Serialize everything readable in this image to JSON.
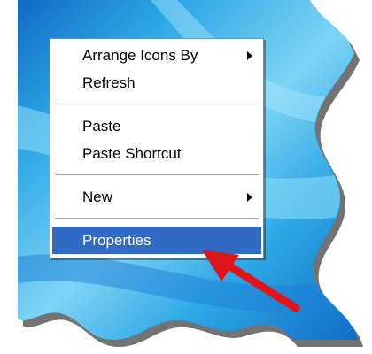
{
  "desktop": {
    "background_colors": {
      "light": "#7fd4f5",
      "mid": "#2fa8e6",
      "dark": "#0b64c2",
      "shadow": "#000000"
    }
  },
  "context_menu": {
    "items": [
      {
        "label": "Arrange Icons By",
        "has_submenu": true
      },
      {
        "label": "Refresh",
        "has_submenu": false
      },
      {
        "label": "Paste",
        "has_submenu": false
      },
      {
        "label": "Paste Shortcut",
        "has_submenu": false
      },
      {
        "label": "New",
        "has_submenu": true
      },
      {
        "label": "Properties",
        "has_submenu": false,
        "selected": true
      }
    ],
    "selection_color": "#316ac5"
  },
  "annotation": {
    "icon": "red-pointer-arrow-icon",
    "color": "#e0141b"
  }
}
